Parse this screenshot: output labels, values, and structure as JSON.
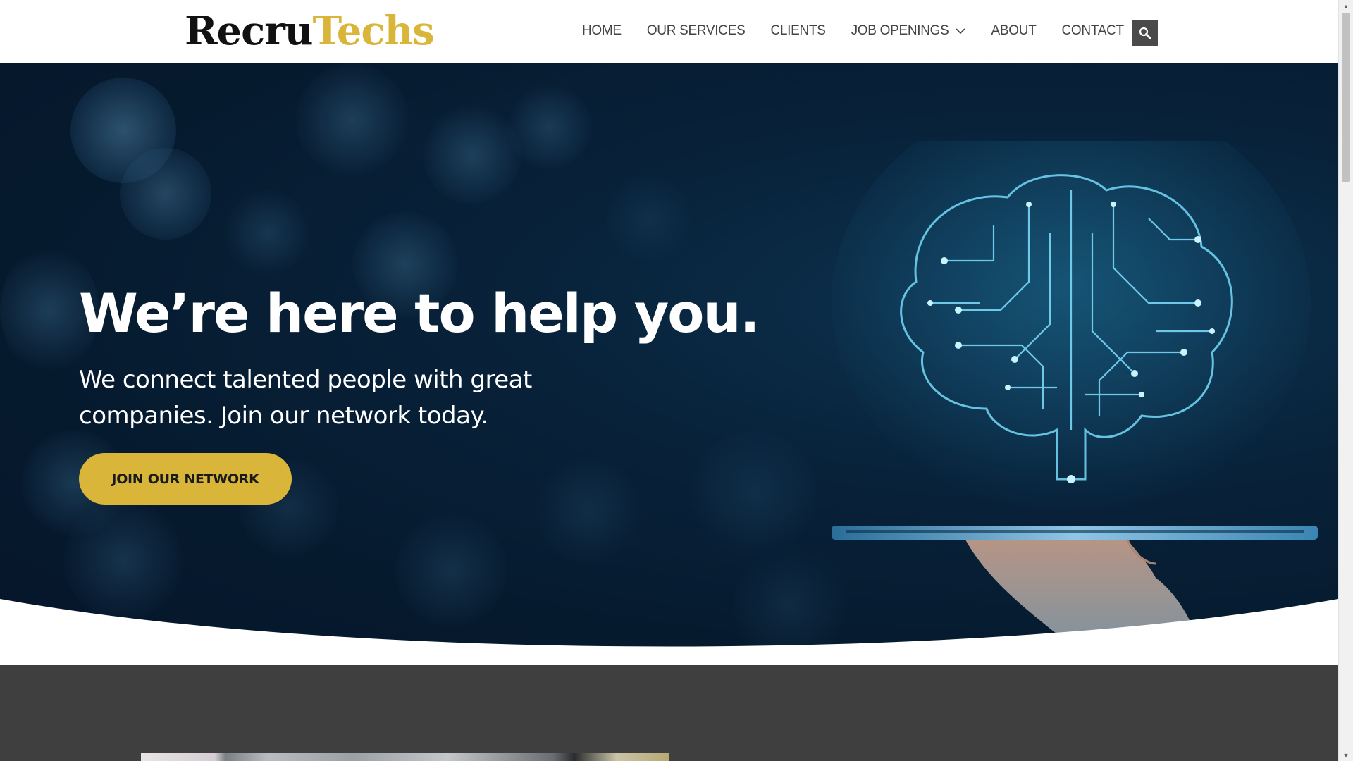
{
  "brand": {
    "part1": "Recru",
    "part2": "Techs",
    "color_dark": "#111111",
    "color_gold": "#d9b53a"
  },
  "nav": {
    "items": [
      {
        "label": "HOME"
      },
      {
        "label": "OUR SERVICES"
      },
      {
        "label": "CLIENTS"
      },
      {
        "label": "JOB OPENINGS",
        "has_dropdown": true
      },
      {
        "label": "ABOUT"
      },
      {
        "label": "CONTACT"
      }
    ],
    "search_icon": "search-icon"
  },
  "hero": {
    "title": "We’re here to help you.",
    "subtitle": "We connect talented people with great companies. Join our network today.",
    "cta_label": "JOIN OUR NETWORK",
    "cta_color": "#d9b53a",
    "illustration": "circuit-brain-over-tablet-on-hand"
  },
  "colors": {
    "hero_bg": "#061a2e",
    "section_dark": "#3f3f3f",
    "nav_text": "#444444"
  }
}
